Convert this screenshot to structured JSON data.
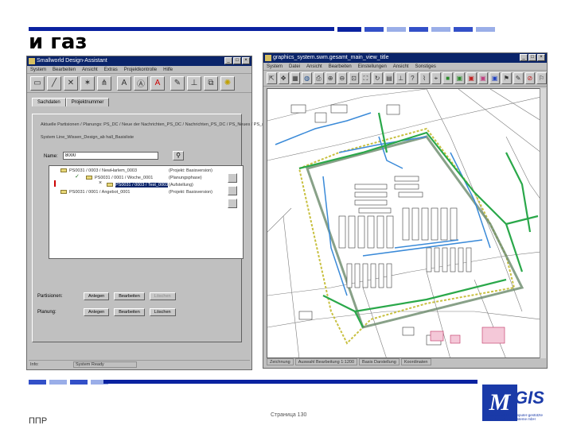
{
  "slide": {
    "title": "и газ",
    "footer_label": "ППР",
    "page": "Страница 130"
  },
  "left_window": {
    "title": "Smallworld Design-Assistant",
    "menu": [
      "System",
      "Bearbeiten",
      "Ansicht",
      "Extras",
      "Projektkontrolle",
      "Hilfe"
    ],
    "tabs": [
      "Sachdaten",
      "Projektnummer"
    ],
    "info_lines": [
      "Aktuelle Partisionen / Planungs: PS_DC / Neue der Nachrichten_PS_DC / Nachrichten_PS_DC / PS_Neues / PS_neue",
      "System Line_Wissen_Design_ab hall_Basisliste"
    ],
    "name_label": "Name:",
    "name_value": "8000",
    "tree": [
      {
        "text": "PS0031 / 0003 / NewHarlem_0003",
        "col2": "(Projekt: Basisversion)"
      },
      {
        "text": "PS0031 / 0001 / Woche_0001",
        "col2": "(Planungsphase)"
      },
      {
        "text": "PS0031 / 0003 / Test_0003",
        "col2": "(Aufstellung)"
      },
      {
        "text": "PS0031 / 0001 / Angebot_0001",
        "col2": "(Projekt: Basisversion)"
      }
    ],
    "actions": [
      {
        "label": "Partisionen:",
        "buttons": [
          "Anlegen",
          "Bearbeiten",
          "Löschen"
        ]
      },
      {
        "label": "Planung:",
        "buttons": [
          "Anlegen",
          "Bearbeiten",
          "Löschen"
        ]
      }
    ],
    "status": {
      "left": "Info:",
      "field": "System Ready"
    }
  },
  "right_window": {
    "title": "graphics_system.swm.gesamt_main_view_title",
    "menu": [
      "System",
      "Datei",
      "Ansicht",
      "Bearbeiten",
      "Einstellungen",
      "Ansicht",
      "Sonstiges"
    ],
    "status": [
      "Zeichnung",
      "Auswahl Bearbeitung 1:1200",
      "Basis Darstellung",
      "Koordinaten"
    ]
  },
  "logo": {
    "name": "MGIS",
    "mark_letter": "M",
    "word": "GIS",
    "sub": "Gesellschaft für Computer-gestützte Geoinformations-Systeme mbH"
  }
}
